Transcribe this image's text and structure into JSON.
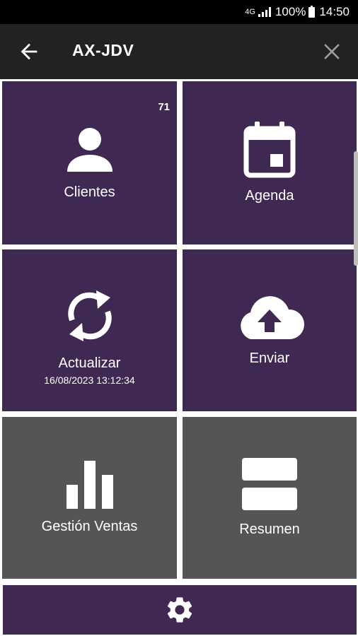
{
  "status_bar": {
    "network": "4G",
    "battery": "100%",
    "time": "14:50"
  },
  "app_bar": {
    "title": "AX-JDV",
    "back_icon": "arrow-left-icon",
    "close_icon": "close-icon"
  },
  "tiles": {
    "clientes": {
      "label": "Clientes",
      "badge": "71",
      "icon": "person-icon"
    },
    "agenda": {
      "label": "Agenda",
      "icon": "calendar-icon"
    },
    "actualizar": {
      "label": "Actualizar",
      "timestamp": "16/08/2023 13:12:34",
      "icon": "sync-icon"
    },
    "enviar": {
      "label": "Enviar",
      "icon": "cloud-upload-icon"
    },
    "gestion_ventas": {
      "label": "Gestión Ventas",
      "icon": "bar-chart-icon"
    },
    "resumen": {
      "label": "Resumen",
      "icon": "summary-icon"
    }
  },
  "settings": {
    "icon": "gear-icon"
  },
  "colors": {
    "tile_purple": "#3f2952",
    "tile_gray": "#555555",
    "app_bar": "#222222"
  }
}
